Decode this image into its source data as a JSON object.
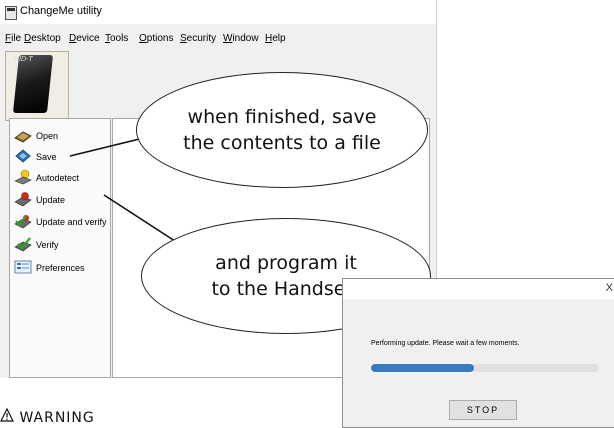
{
  "window": {
    "title": "ChangeMe utility"
  },
  "menu": [
    {
      "label": "File"
    },
    {
      "label": "Desktop"
    },
    {
      "label": "Device"
    },
    {
      "label": "Tools"
    },
    {
      "label": "Options"
    },
    {
      "label": "Security"
    },
    {
      "label": "Window"
    },
    {
      "label": "Help"
    }
  ],
  "handset": {
    "label": "HID-T"
  },
  "sidebar": {
    "items": [
      {
        "label": "Open",
        "icon": "open-book-icon"
      },
      {
        "label": "Save",
        "icon": "save-diamond-icon"
      },
      {
        "label": "Autodetect",
        "icon": "autodetect-icon"
      },
      {
        "label": "Update",
        "icon": "update-icon"
      },
      {
        "label": "Update and verify",
        "icon": "update-verify-icon"
      },
      {
        "label": "Verify",
        "icon": "verify-check-icon"
      },
      {
        "label": "Preferences",
        "icon": "preferences-icon"
      }
    ]
  },
  "callouts": {
    "save": {
      "line1": "when finished, save",
      "line2": "the contents to a file"
    },
    "program": {
      "line1": "and program it",
      "line2": "to the Handset!"
    }
  },
  "dialog": {
    "message": "Performing update. Please wait a few moments.",
    "progress": 0.45,
    "stop_label": "STOP",
    "close_symbol": "X"
  },
  "warning": {
    "label": "WARNING"
  },
  "colors": {
    "accent": "#3a79c2",
    "window_bg": "#f0f0f0",
    "panel_border": "#a8a8a8"
  }
}
